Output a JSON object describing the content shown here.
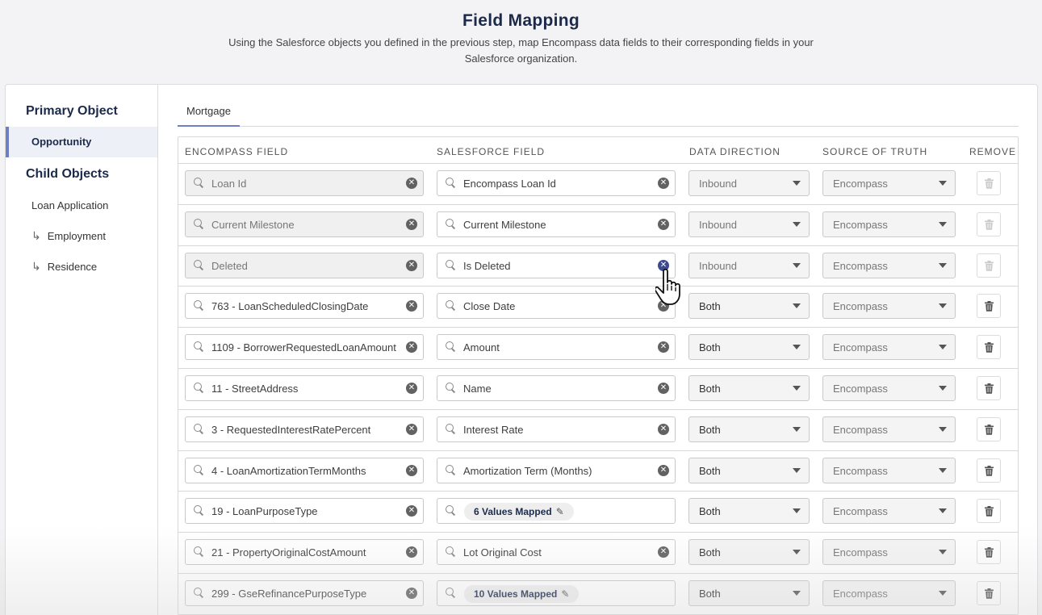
{
  "header": {
    "title": "Field Mapping",
    "subtitle_line1": "Using the Salesforce objects you defined in the previous step, map Encompass data fields to their corresponding fields in your",
    "subtitle_line2": "Salesforce organization."
  },
  "sidebar": {
    "primary_heading": "Primary Object",
    "primary_item": "Opportunity",
    "child_heading": "Child Objects",
    "child_items": [
      "Loan Application",
      "Employment",
      "Residence"
    ]
  },
  "tabs": [
    "Mortgage"
  ],
  "columns": [
    "ENCOMPASS FIELD",
    "SALESFORCE FIELD",
    "DATA DIRECTION",
    "SOURCE OF TRUTH",
    "REMOVE"
  ],
  "rows": [
    {
      "encompass": "Loan Id",
      "salesforce": "Encompass Loan Id",
      "direction": "Inbound",
      "source": "Encompass"
    },
    {
      "encompass": "Current Milestone",
      "salesforce": "Current Milestone",
      "direction": "Inbound",
      "source": "Encompass"
    },
    {
      "encompass": "Deleted",
      "salesforce": "Is Deleted",
      "direction": "Inbound",
      "source": "Encompass"
    },
    {
      "encompass": "763 - LoanScheduledClosingDate",
      "salesforce": "Close Date",
      "direction": "Both",
      "source": "Encompass"
    },
    {
      "encompass": "1109 - BorrowerRequestedLoanAmount",
      "salesforce": "Amount",
      "direction": "Both",
      "source": "Encompass"
    },
    {
      "encompass": "11 - StreetAddress",
      "salesforce": "Name",
      "direction": "Both",
      "source": "Encompass"
    },
    {
      "encompass": "3 - RequestedInterestRatePercent",
      "salesforce": "Interest Rate",
      "direction": "Both",
      "source": "Encompass"
    },
    {
      "encompass": "4 - LoanAmortizationTermMonths",
      "salesforce": "Amortization Term (Months)",
      "direction": "Both",
      "source": "Encompass"
    },
    {
      "encompass": "19 - LoanPurposeType",
      "salesforce_pill": "6 Values Mapped",
      "direction": "Both",
      "source": "Encompass"
    },
    {
      "encompass": "21 - PropertyOriginalCostAmount",
      "salesforce": "Lot Original Cost",
      "direction": "Both",
      "source": "Encompass"
    },
    {
      "encompass": "299 - GseRefinancePurposeType",
      "salesforce_pill": "10 Values Mapped",
      "direction": "Both",
      "source": "Encompass"
    }
  ],
  "icons": {
    "search": "search-icon",
    "clear": "clear-icon",
    "trash": "trash-icon",
    "edit": "pencil-icon",
    "caret": "chevron-down-icon",
    "subitem": "return-arrow-icon"
  },
  "colors": {
    "accent": "#6f7fc4",
    "heading": "#1b2a4a",
    "clear_active": "#3e4a8f"
  }
}
